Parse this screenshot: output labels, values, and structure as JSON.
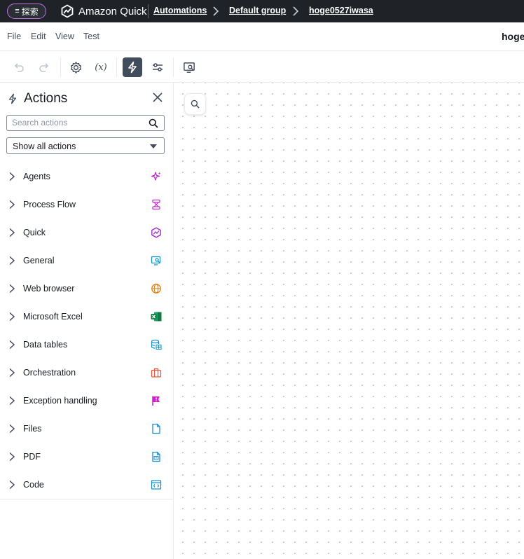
{
  "topbar": {
    "explore_label": "探索",
    "brand_name": "Amazon Quick",
    "breadcrumbs": [
      "Automations",
      "Default group",
      "hoge0527iwasa"
    ]
  },
  "menubar": {
    "items": [
      "File",
      "Edit",
      "View",
      "Test"
    ],
    "document_title": "hoge"
  },
  "toolbar": {
    "variables_label": "(x)",
    "buttons": [
      "undo-icon",
      "redo-icon",
      "settings-icon",
      "variables-icon",
      "actions-icon",
      "sliders-icon",
      "screen-capture-icon"
    ],
    "active_button": "actions-icon"
  },
  "sidebar": {
    "title": "Actions",
    "search_placeholder": "Search actions",
    "filter_value": "Show all actions",
    "categories": [
      {
        "label": "Agents",
        "icon": "sparkle-icon",
        "color": "#c02fcb"
      },
      {
        "label": "Process Flow",
        "icon": "process-flow-icon",
        "color": "#c02fcb"
      },
      {
        "label": "Quick",
        "icon": "quick-icon",
        "color": "#a72dcc"
      },
      {
        "label": "General",
        "icon": "screen-search-icon",
        "color": "#1b8fc9"
      },
      {
        "label": "Web browser",
        "icon": "globe-icon",
        "color": "#e07b0e"
      },
      {
        "label": "Microsoft Excel",
        "icon": "excel-icon",
        "color": "#107c41"
      },
      {
        "label": "Data tables",
        "icon": "data-table-icon",
        "color": "#1b8fc9"
      },
      {
        "label": "Orchestration",
        "icon": "briefcase-icon",
        "color": "#e8553e"
      },
      {
        "label": "Exception handling",
        "icon": "flag-icon",
        "color": "#d31ed0"
      },
      {
        "label": "Files",
        "icon": "file-icon",
        "color": "#1b8fc9"
      },
      {
        "label": "PDF",
        "icon": "pdf-icon",
        "color": "#1b8fc9"
      },
      {
        "label": "Code",
        "icon": "code-icon",
        "color": "#1b8fc9"
      }
    ]
  },
  "colors": {
    "topbar_bg": "#1f2328",
    "explore_border": "#c56be8",
    "active_tool_bg": "#414d5c"
  }
}
